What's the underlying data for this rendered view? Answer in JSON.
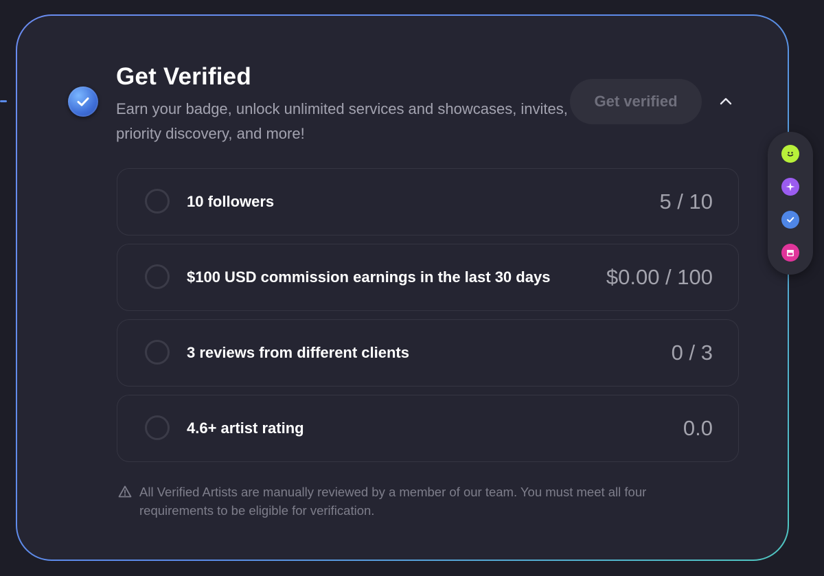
{
  "card": {
    "title": "Get Verified",
    "subtitle": "Earn your badge, unlock unlimited services and showcases, invites, priority discovery, and more!",
    "cta_label": "Get verified"
  },
  "requirements": [
    {
      "label": "10 followers",
      "value": "5 / 10"
    },
    {
      "label": "$100 USD commission earnings in the last 30 days",
      "value": "$0.00 / 100"
    },
    {
      "label": "3 reviews from different clients",
      "value": "0 / 3"
    },
    {
      "label": "4.6+ artist rating",
      "value": "0.0"
    }
  ],
  "disclaimer": "All Verified Artists are manually reviewed by a member of our team. You must meet all four requirements to be eligible for verification.",
  "side_rail": [
    {
      "icon": "smile-icon",
      "color": "#b8f03a"
    },
    {
      "icon": "sparkle-icon",
      "color": "#9b5cf0"
    },
    {
      "icon": "check-badge-icon",
      "color": "#4f86e6"
    },
    {
      "icon": "shop-icon",
      "color": "#e0359a"
    }
  ],
  "colors": {
    "background": "#1d1d27",
    "card": "#252532",
    "border_gradient_start": "#6a8cf0",
    "border_gradient_end": "#4fc7c0",
    "verified_blue": "#3f6fd8"
  }
}
